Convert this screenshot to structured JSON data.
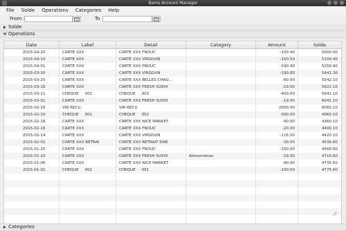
{
  "window": {
    "title": "Bams Account Manager"
  },
  "menu": {
    "items": [
      "File",
      "Solde",
      "Operations",
      "Categories",
      "Help"
    ]
  },
  "filter": {
    "from_label": "From :",
    "to_label": "To"
  },
  "sections": {
    "solde": "Solde",
    "operations": "Operations",
    "categories": "Categories"
  },
  "table": {
    "columns": [
      "Date",
      "Label",
      "Detail",
      "Category",
      "Amount",
      "Solde"
    ],
    "rows": [
      [
        "2015-04-20",
        "CARTE XXX",
        "CARTE XXX FNOUC",
        "",
        "-100.40",
        "5000.00"
      ],
      [
        "2015-04-10",
        "CARTE XXX",
        "CARTE XXX VIRGOUN",
        "",
        "-150.50",
        "5100.40"
      ],
      [
        "2015-04-01",
        "CARTE XXX",
        "CARTE XXX FNOUC",
        "",
        "-190.40",
        "5250.90"
      ],
      [
        "2015-03-30",
        "CARTE XXX",
        "CARTE XXX VIRGOUN",
        "",
        "-190.80",
        "5441.30"
      ],
      [
        "2015-03-25",
        "CARTE XXX",
        "CARTE XXX BELLES CHAU...",
        "",
        "-80.00",
        "5542.10"
      ],
      [
        "2015-03-16",
        "CARTE XXX",
        "CARTE XXX FRESH SUSHI",
        "",
        "-19.00",
        "5622.10"
      ],
      [
        "2015-03-11",
        "CHEQUE     001",
        "CHEQUE     003",
        "",
        "-400.00",
        "5641.10"
      ],
      [
        "2015-03-01",
        "CARTE XXX",
        "CARTE XXX FRESH SUSHI",
        "",
        "-19.00",
        "6041.10"
      ],
      [
        "2015-02-26",
        "VIR RECU",
        "VIR RECU",
        "",
        "2000.00",
        "6060.10"
      ],
      [
        "2015-02-20",
        "CHEQUE     001",
        "CHEQUE     002",
        "",
        "-300.00",
        "4060.10"
      ],
      [
        "2015-02-18",
        "CARTE XXX",
        "CARTE XXX NICE MARKET",
        "",
        "-40.00",
        "4360.10"
      ],
      [
        "2015-02-16",
        "CARTE XXX",
        "CARTE XXX FNOUC",
        "",
        "-20.00",
        "4400.10"
      ],
      [
        "2015-02-14",
        "CARTE XXX",
        "CARTE XXX VIRGOUN",
        "",
        "-116.50",
        "4420.10"
      ],
      [
        "2015-02-01",
        "CARTE XXX RETRAI",
        "CARTE XXX RETRAIT DAB",
        "",
        "-30.00",
        "4536.60"
      ],
      [
        "2015-01-25",
        "CARTE XXX",
        "CARTE XXX FNOUC",
        "",
        "-150.00",
        "4566.60"
      ],
      [
        "2015-01-20",
        "CARTE XXX",
        "CARTE XXX FRESH SUSHI",
        "Alimentation",
        "-19.00",
        "4716.60"
      ],
      [
        "2015-01-06",
        "CARTE XXX",
        "CARTE XXX NICE MARKET",
        "",
        "-40.00",
        "4735.60"
      ],
      [
        "2015-01-01",
        "CHEQUE     001",
        "CHEQUE     001",
        "",
        "-100.00",
        "4775.60"
      ]
    ]
  }
}
